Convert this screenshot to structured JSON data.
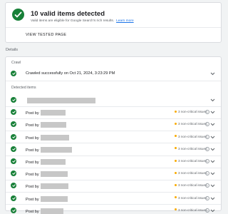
{
  "summary": {
    "title": "10 valid items detected",
    "subtitle": "Valid items are eligible for Google Search's rich results.",
    "learn_more": "Learn more",
    "view_tested_page": "VIEW TESTED PAGE"
  },
  "details": {
    "label": "Details",
    "crawl": {
      "title": "Crawl",
      "status": "Crawled successfully on Oct 21, 2024, 3:23:29 PM"
    },
    "detected": {
      "title": "Detected items",
      "items": [
        {
          "label": "",
          "issues": ""
        },
        {
          "label": "Post by",
          "issues": "3 non-critical issues"
        },
        {
          "label": "Post by",
          "issues": "3 non-critical issues"
        },
        {
          "label": "Post by",
          "issues": "3 non-critical issues"
        },
        {
          "label": "Post by",
          "issues": "3 non-critical issues"
        },
        {
          "label": "Post by",
          "issues": "3 non-critical issues"
        },
        {
          "label": "Post by",
          "issues": "3 non-critical issues"
        },
        {
          "label": "Post by",
          "issues": "3 non-critical issues"
        },
        {
          "label": "Post by",
          "issues": "3 non-critical issues"
        },
        {
          "label": "Post by",
          "issues": "3 non-critical issues"
        }
      ]
    }
  },
  "colors": {
    "valid": "#188038",
    "warning": "#f9ab00",
    "link": "#1a73e8"
  },
  "icons": {
    "valid": "check-circle-icon",
    "expand": "chevron-down-icon",
    "help": "help-circle-icon",
    "warning": "warning-dot-icon"
  }
}
